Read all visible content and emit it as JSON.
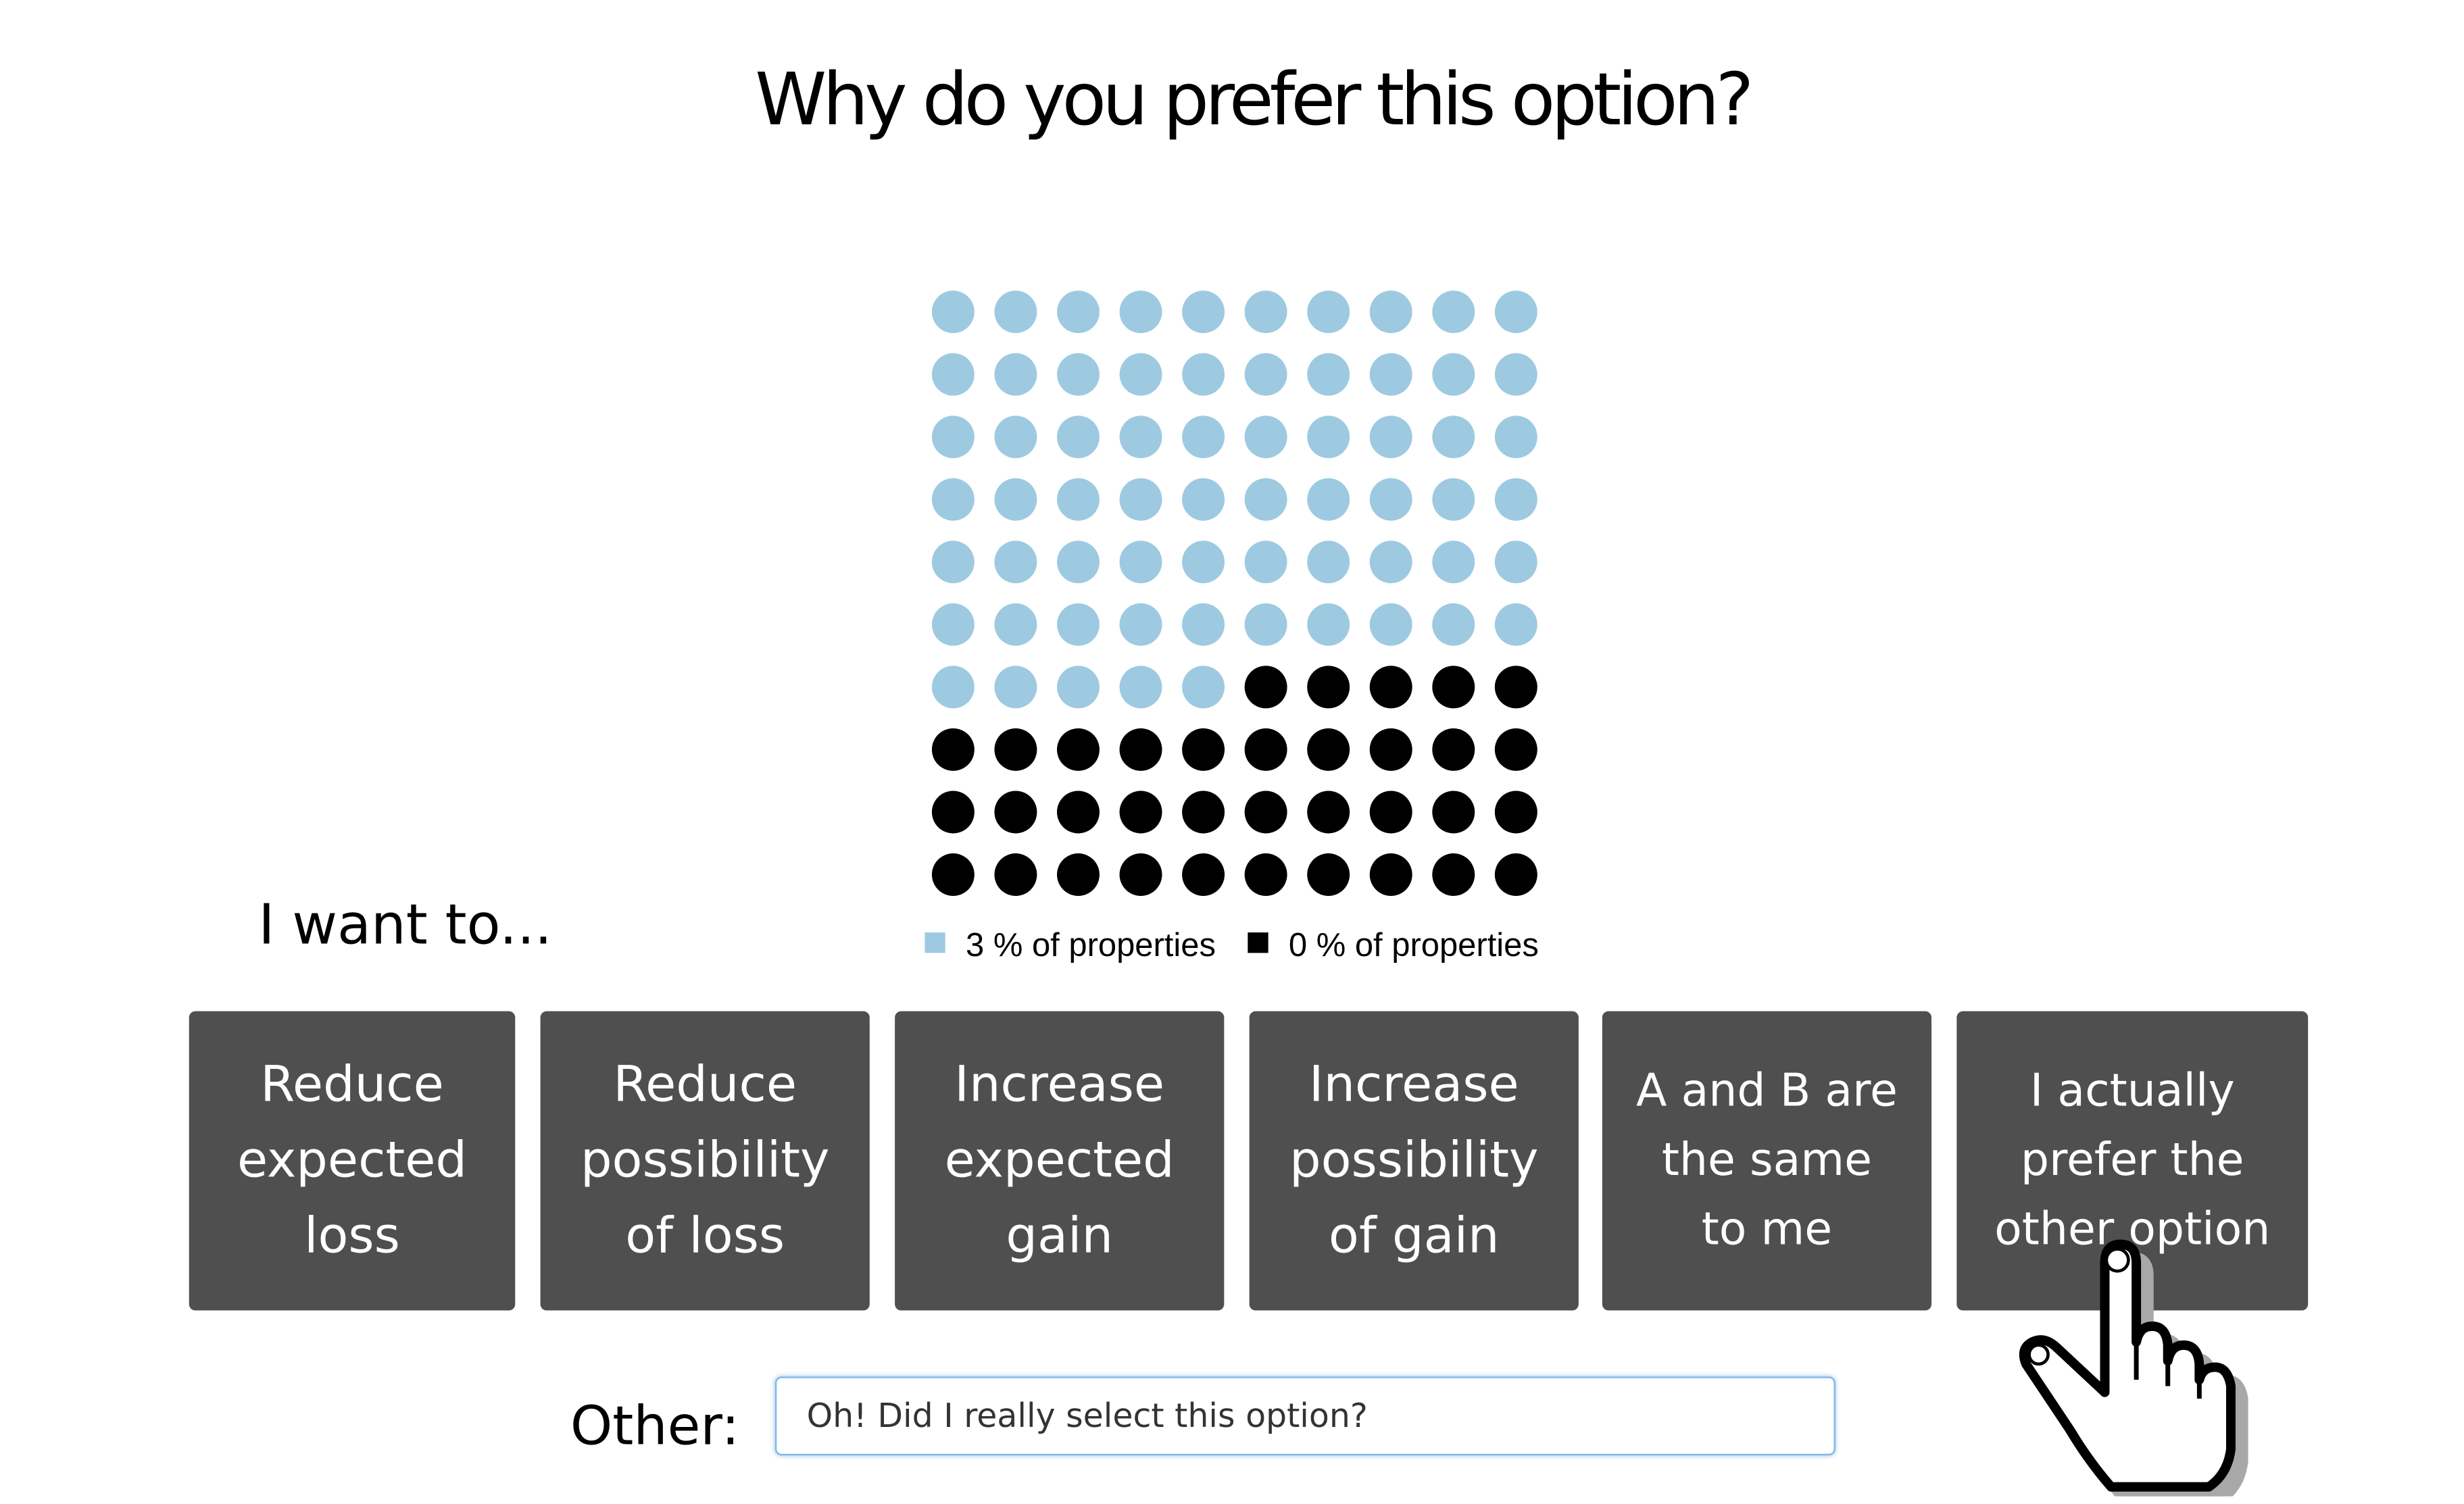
{
  "question": {
    "title": "Why do you prefer this option?"
  },
  "chart_data": {
    "type": "waffle",
    "grid": {
      "rows": 10,
      "cols": 10
    },
    "series": [
      {
        "name": "3 % of properties",
        "count": 65,
        "color": "#9ecae1"
      },
      {
        "name": "0 % of properties",
        "count": 35,
        "color": "#000000"
      }
    ],
    "fill_order": "light points first, row by row from top-left",
    "legend": "bottom"
  },
  "prompt": {
    "label": "I want to..."
  },
  "options": [
    {
      "label": "Reduce\nexpected\nloss"
    },
    {
      "label": "Reduce\npossibility\nof loss"
    },
    {
      "label": "Increase\nexpected\ngain"
    },
    {
      "label": "Increase\npossibility\nof gain"
    },
    {
      "label": "A and B are\nthe same\nto me"
    },
    {
      "label": "I actually\nprefer the\nother option"
    }
  ],
  "other": {
    "label": "Other:",
    "value": "Oh! Did I really select this option?"
  },
  "colors": {
    "button_bg": "#4f4f4f",
    "light_dot": "#9ecae1",
    "dark_dot": "#000000",
    "input_border": "#7fb5e8"
  },
  "icons": {
    "pointer": "hand-pointer-icon"
  }
}
